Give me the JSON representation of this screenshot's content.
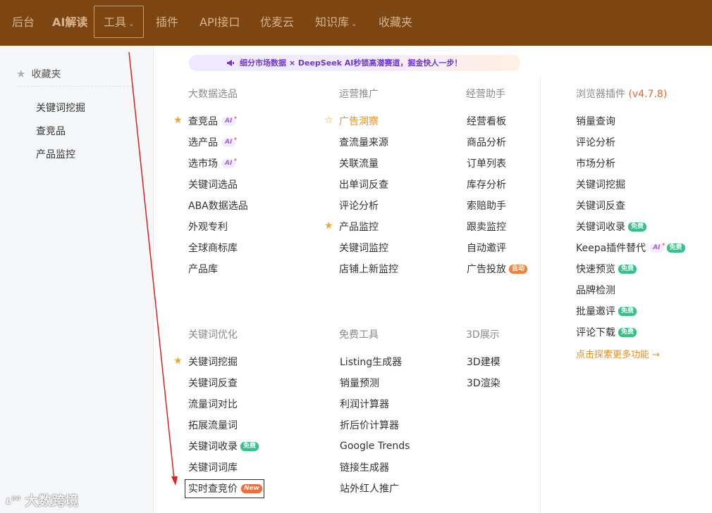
{
  "nav": {
    "items": [
      "后台",
      "AI解读",
      "工具",
      "插件",
      "API接口",
      "优麦云",
      "知识库",
      "收藏夹"
    ],
    "tools_caret": "⌄",
    "kb_caret": "⌄"
  },
  "sidebar": {
    "title": "收藏夹",
    "items": [
      "关键词挖掘",
      "查竞品",
      "产品监控"
    ]
  },
  "promo": {
    "text": "细分市场数据 × DeepSeek AI秒锁高潜赛道，掘金快人一步！"
  },
  "sections": {
    "big_data": {
      "title": "大数据选品",
      "items": [
        "查竞品",
        "选产品",
        "选市场",
        "关键词选品",
        "ABA数据选品",
        "外观专利",
        "全球商标库",
        "产品库"
      ]
    },
    "marketing": {
      "title": "运营推广",
      "items": [
        "广告洞察",
        "查流量来源",
        "关联流量",
        "出单词反查",
        "评论分析",
        "产品监控",
        "关键词监控",
        "店铺上新监控"
      ]
    },
    "assistant": {
      "title": "经营助手",
      "items": [
        "经营看板",
        "商品分析",
        "订单列表",
        "库存分析",
        "索赔助手",
        "跟卖监控",
        "自动邀评",
        "广告投放"
      ]
    },
    "browser_plugin": {
      "title": "浏览器插件",
      "version": "(v4.7.8)",
      "items": [
        "销量查询",
        "评论分析",
        "市场分析",
        "关键词挖掘",
        "关键词反查",
        "关键词收录",
        "Keepa插件替代",
        "快速预览",
        "品牌检测",
        "批量邀评",
        "评论下载"
      ],
      "more": "点击探索更多功能 →"
    },
    "keyword_opt": {
      "title": "关键词优化",
      "items": [
        "关键词挖掘",
        "关键词反查",
        "流量词对比",
        "拓展流量词",
        "关键词收录",
        "关键词词库",
        "实时查竞价"
      ]
    },
    "free_tools": {
      "title": "免费工具",
      "items": [
        "Listing生成器",
        "销量预测",
        "利润计算器",
        "折后价计算器",
        "Google Trends",
        "链接生成器",
        "站外红人推广"
      ]
    },
    "display_3d": {
      "title": "3D展示",
      "items": [
        "3D建模",
        "3D渲染"
      ]
    }
  },
  "badges": {
    "ai": "AI",
    "free": "免费",
    "auto": "自动",
    "new": "New"
  },
  "watermark": {
    "logo": "ʟ⁰⁰",
    "text": "大数跨境"
  },
  "colors": {
    "nav_bg": "#7c4511",
    "accent_orange": "#ee9020",
    "star": "#f5a623",
    "free_green": "#35c289",
    "annotation_red": "#e02020"
  }
}
